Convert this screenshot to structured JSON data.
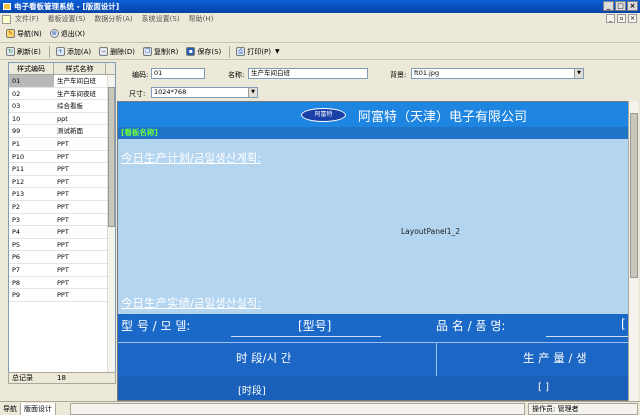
{
  "window": {
    "title": "电子看板管理系统 - [版面设计]"
  },
  "menu": [
    "文件(F)",
    "看板设置(S)",
    "数据分析(A)",
    "系统设置(S)",
    "帮助(H)"
  ],
  "navbar": {
    "nav_label": "导航(N)",
    "exit_label": "退出(X)"
  },
  "toolbar": {
    "refresh": "刷新(E)",
    "add": "添加(A)",
    "delete": "删除(D)",
    "copy": "复制(R)",
    "save": "保存(S)",
    "print": "打印(P)"
  },
  "grid": {
    "headers": [
      "样式编码",
      "样式名称"
    ],
    "rows": [
      [
        "01",
        "生产车间白班"
      ],
      [
        "02",
        "生产车间夜班"
      ],
      [
        "03",
        "综合看板"
      ],
      [
        "10",
        "ppt"
      ],
      [
        "99",
        "测试新面"
      ],
      [
        "P1",
        "PPT"
      ],
      [
        "P10",
        "PPT"
      ],
      [
        "P11",
        "PPT"
      ],
      [
        "P12",
        "PPT"
      ],
      [
        "P13",
        "PPT"
      ],
      [
        "P2",
        "PPT"
      ],
      [
        "P3",
        "PPT"
      ],
      [
        "P4",
        "PPT"
      ],
      [
        "P5",
        "PPT"
      ],
      [
        "P6",
        "PPT"
      ],
      [
        "P7",
        "PPT"
      ],
      [
        "P8",
        "PPT"
      ],
      [
        "P9",
        "PPT"
      ]
    ],
    "total_label": "总记录",
    "total_value": "18"
  },
  "form": {
    "code_label": "编码:",
    "code_value": "01",
    "name_label": "名称:",
    "name_value": "生产车间白班",
    "bg_label": "背景:",
    "bg_value": "ft01.jpg",
    "size_label": "尺寸:",
    "size_value": "1024*768"
  },
  "canvas": {
    "logo_text": "阿富特",
    "company": "阿富特（天津）电子有限公司",
    "plate": "[看板名称]",
    "plan_title": "今日生产计划/금일생산계획:",
    "panel_label": "LayoutPanel1_2",
    "actual_title": "今日生产实绩/금일생산실적:",
    "model_label": "型 号 / 모 델:",
    "model_value": "[型号]",
    "product_label": "品 名 / 품 명:",
    "product_value": "[",
    "time_header": "时 段/시 간",
    "qty_header": "生 产 量 / 생",
    "row_time": "[时段]",
    "row_qty": "[ ]"
  },
  "statusbar": {
    "tabs": [
      "导航",
      "版面设计"
    ],
    "operator": "操作员: 管理者"
  }
}
